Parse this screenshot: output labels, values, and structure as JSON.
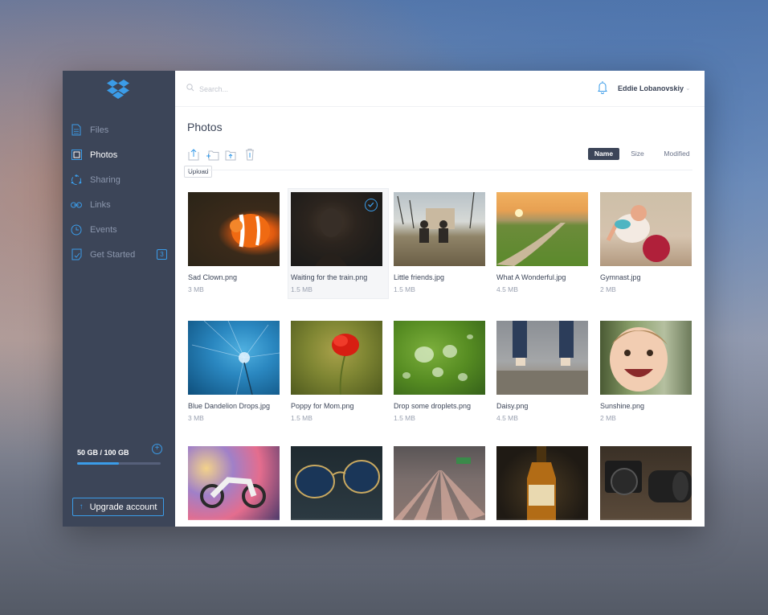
{
  "sidebar": {
    "logo": "dropbox-logo",
    "items": [
      {
        "label": "Files",
        "icon": "file-icon",
        "active": false
      },
      {
        "label": "Photos",
        "icon": "photo-icon",
        "active": true
      },
      {
        "label": "Sharing",
        "icon": "sharing-icon",
        "active": false
      },
      {
        "label": "Links",
        "icon": "link-icon",
        "active": false
      },
      {
        "label": "Events",
        "icon": "clock-icon",
        "active": false
      },
      {
        "label": "Get Started",
        "icon": "get-started-icon",
        "active": false,
        "badge": "3"
      }
    ],
    "storage": {
      "label": "50 GB / 100 GB",
      "used_fraction": 0.5
    },
    "upgrade_label": "Upgrade account"
  },
  "topbar": {
    "search_placeholder": "Search...",
    "user_name": "Eddie Lobanovskiy"
  },
  "page": {
    "title": "Photos",
    "tooltip": "Upload",
    "sort": {
      "name": "Name",
      "size": "Size",
      "modified": "Modified",
      "active": "Name"
    }
  },
  "photos": [
    {
      "name": "Sad Clown.png",
      "size": "3 MB"
    },
    {
      "name": "Waiting for the train.png",
      "size": "1.5 MB",
      "selected": true
    },
    {
      "name": "Little friends.jpg",
      "size": "1.5 MB"
    },
    {
      "name": "What A Wonderful.jpg",
      "size": "4.5 MB"
    },
    {
      "name": "Gymnast.jpg",
      "size": "2 MB"
    },
    {
      "name": "Blue Dandelion Drops.jpg",
      "size": "3 MB"
    },
    {
      "name": "Poppy for Mom.png",
      "size": "1.5 MB"
    },
    {
      "name": "Drop some droplets.png",
      "size": "1.5 MB"
    },
    {
      "name": "Daisy.png",
      "size": "4.5 MB"
    },
    {
      "name": "Sunshine.png",
      "size": "2 MB"
    },
    {
      "name": "",
      "size": ""
    },
    {
      "name": "",
      "size": ""
    },
    {
      "name": "",
      "size": ""
    },
    {
      "name": "",
      "size": ""
    },
    {
      "name": "",
      "size": ""
    }
  ],
  "colors": {
    "accent": "#3b9ce8",
    "sidebar": "#3c4558"
  }
}
